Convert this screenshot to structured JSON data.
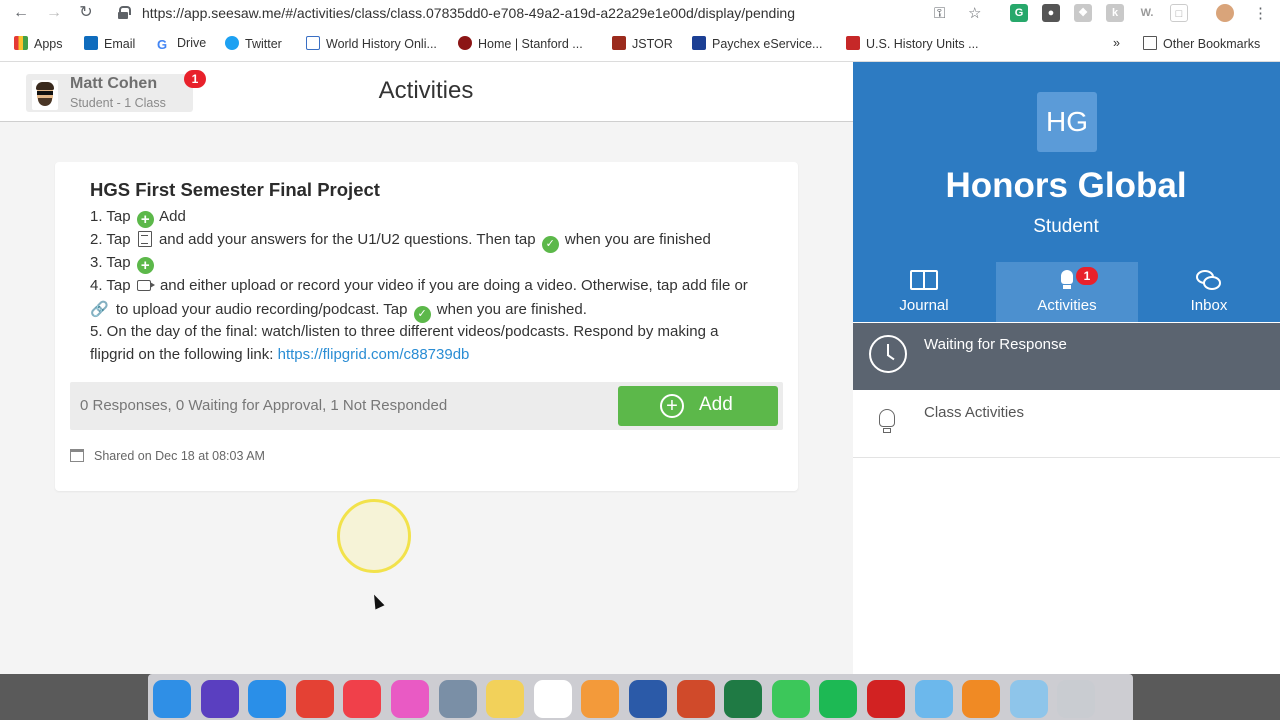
{
  "browser": {
    "url": "https://app.seesaw.me/#/activities/class/class.07835dd0-e708-49a2-a19d-a22a29e1e00d/display/pending",
    "bookmarks": [
      {
        "label": "Apps"
      },
      {
        "label": "Email"
      },
      {
        "label": "Drive"
      },
      {
        "label": "Twitter"
      },
      {
        "label": "World History Onli..."
      },
      {
        "label": "Home | Stanford ..."
      },
      {
        "label": "JSTOR"
      },
      {
        "label": "Paychex eService..."
      },
      {
        "label": "U.S. History Units ..."
      }
    ],
    "overflow_label": "»",
    "other_bookmarks": "Other Bookmarks"
  },
  "header": {
    "user_name": "Matt Cohen",
    "user_role": "Student - 1 Class",
    "notification_count": "1",
    "page_title": "Activities"
  },
  "activity": {
    "title": "HGS First Semester Final Project",
    "step1_a": "1. Tap",
    "step1_b": "Add",
    "step2_a": "2. Tap",
    "step2_b": "and add your answers for the U1/U2 questions. Then tap",
    "step2_c": "when you are finished",
    "step3_a": "3. Tap",
    "step4_a": "4. Tap",
    "step4_b": "and either upload or record your video if you are doing a video. Otherwise, tap add file or",
    "step4_c": "to upload your audio recording/podcast. Tap",
    "step4_d": "when you are finished.",
    "step5_a": "5. On the day of the final: watch/listen to three different videos/podcasts. Respond by making a",
    "step5_b": "flipgrid on the following link:",
    "link": "https://flipgrid.com/c88739db",
    "responses": "0 Responses, 0 Waiting for Approval, 1 Not Responded",
    "add_label": "Add",
    "shared": "Shared on Dec 18 at 08:03 AM"
  },
  "class_panel": {
    "initials": "HG",
    "name": "Honors Global",
    "role": "Student",
    "tabs": [
      {
        "label": "Journal"
      },
      {
        "label": "Activities",
        "badge": "1"
      },
      {
        "label": "Inbox"
      }
    ],
    "waiting_label": "Waiting for Response",
    "class_activities_label": "Class Activities"
  },
  "colors": {
    "brand_blue": "#2d7bc2",
    "active_tab": "#4c90cf",
    "add_green": "#5cb84a",
    "badge_red": "#e8212b",
    "link_blue": "#2a8dd4"
  },
  "dock": {
    "apps": [
      {
        "icon": "finder-icon",
        "color": "#2f8fe6"
      },
      {
        "icon": "siri-icon",
        "color": "#5a3fc0"
      },
      {
        "icon": "safari-icon",
        "color": "#2a8fe8"
      },
      {
        "icon": "chrome-icon",
        "color": "#e44134"
      },
      {
        "icon": "news-icon",
        "color": "#f0404a"
      },
      {
        "icon": "itunes-icon",
        "color": "#e95ac4"
      },
      {
        "icon": "preview-icon",
        "color": "#7a8fa6"
      },
      {
        "icon": "stickies-icon",
        "color": "#f2d15a"
      },
      {
        "icon": "calendar-icon",
        "color": "#ffffff"
      },
      {
        "icon": "photos-icon",
        "color": "#f39a3a"
      },
      {
        "icon": "word-icon",
        "color": "#2b5aa8"
      },
      {
        "icon": "powerpoint-icon",
        "color": "#d04a2a"
      },
      {
        "icon": "excel-icon",
        "color": "#1f7a44"
      },
      {
        "icon": "whatsapp-icon",
        "color": "#3cc75a"
      },
      {
        "icon": "spotify-icon",
        "color": "#1db954"
      },
      {
        "icon": "record-icon",
        "color": "#d22222"
      },
      {
        "icon": "folder-icon",
        "color": "#6cb8ec"
      },
      {
        "icon": "vlc-icon",
        "color": "#f08a24"
      },
      {
        "icon": "screen-recorder-icon",
        "color": "#8ec5ea"
      },
      {
        "icon": "trash-icon",
        "color": "#c9ccd1"
      }
    ]
  }
}
